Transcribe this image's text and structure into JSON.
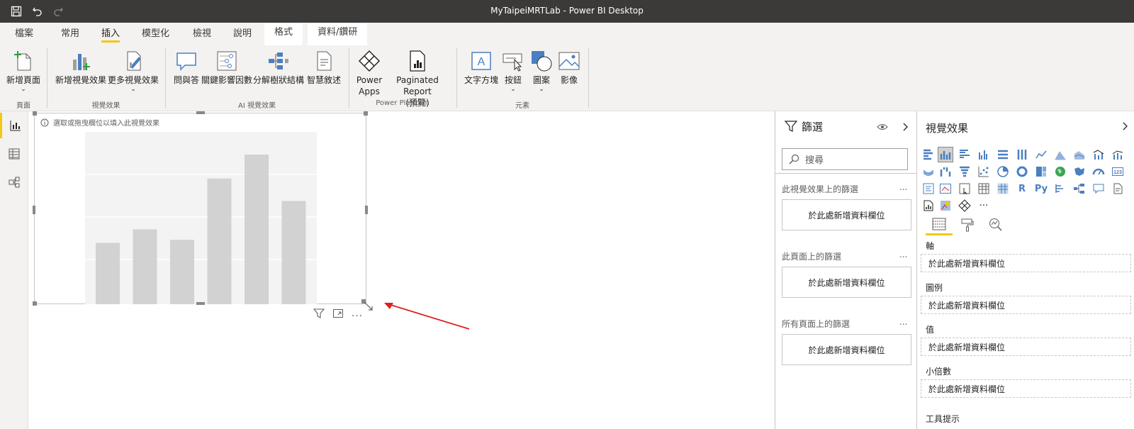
{
  "window": {
    "title": "MyTaipeiMRTLab - Power BI Desktop"
  },
  "quick_access": {
    "save": "save-icon",
    "undo": "undo-icon",
    "redo": "redo-icon"
  },
  "tabs": [
    "檔案",
    "常用",
    "插入",
    "模型化",
    "檢視",
    "說明",
    "格式",
    "資料/鑽研"
  ],
  "active_tab": "插入",
  "ribbon": {
    "new_page": "新增頁面",
    "new_visual": "新增視覺效果",
    "more_visuals": "更多視覺效果",
    "qa": "問與答",
    "key_influencers": "關鍵影響因數",
    "decomposition_tree": "分解樹狀結構",
    "smart_narrative": "智慧敘述",
    "power_apps_1": "Power",
    "power_apps_2": "Apps",
    "paginated_1": "Paginated Report",
    "paginated_2": "(預覽)",
    "text_box": "文字方塊",
    "buttons": "按鈕",
    "shapes": "圖案",
    "image": "影像",
    "chevron": "⌄",
    "groups": {
      "pages": "頁面",
      "visuals": "視覺效果",
      "ai": "AI 視覺效果",
      "power_platform": "Power Platform",
      "elements": "元素"
    }
  },
  "visual": {
    "hint": "選取或拖曳欄位以填入此視覺效果",
    "placeholder_bars": [
      0.41,
      0.5,
      0.43,
      0.84,
      1.0,
      0.69
    ]
  },
  "filters_pane": {
    "title": "篩選",
    "search_placeholder": "搜尋",
    "sections": [
      {
        "label": "此視覺效果上的篩選",
        "drop": "於此處新增資料欄位"
      },
      {
        "label": "此頁面上的篩選",
        "drop": "於此處新增資料欄位"
      },
      {
        "label": "所有頁面上的篩選",
        "drop": "於此處新增資料欄位"
      }
    ],
    "more": "..."
  },
  "viz_pane": {
    "title": "視覺效果",
    "wells": [
      {
        "label": "軸",
        "drop": "於此處新增資料欄位"
      },
      {
        "label": "圖例",
        "drop": "於此處新增資料欄位"
      },
      {
        "label": "值",
        "drop": "於此處新增資料欄位"
      },
      {
        "label": "小倍數",
        "drop": "於此處新增資料欄位"
      }
    ],
    "tooltip_label": "工具提示",
    "icons": {
      "r": "R",
      "py": "Py",
      "more": "···"
    }
  },
  "colors": {
    "accent": "#f2c811",
    "titlebar": "#3b3a39",
    "placeholder_bar": "#d2d2d2",
    "arrow": "#e02020"
  }
}
